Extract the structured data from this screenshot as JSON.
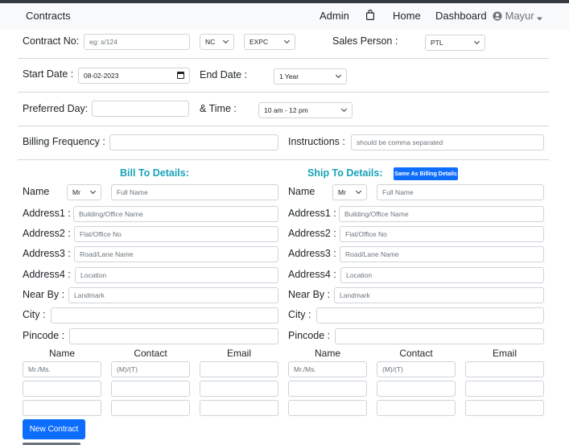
{
  "nav": {
    "brand": "Contracts",
    "admin": "Admin",
    "home": "Home",
    "dashboard": "Dashboard",
    "user": "Mayur"
  },
  "form": {
    "contract_no_label": "Contract No:",
    "contract_no_placeholder": "eg: s/124",
    "nc_value": "NC",
    "expc_value": "EXPC",
    "sales_person_label": "Sales Person :",
    "sales_person_value": "PTL",
    "start_date_label": "Start Date :",
    "start_date_value": "08-02-2023",
    "end_date_label": "End Date :",
    "end_date_value": "1 Year",
    "preferred_day_label": "Preferred Day:",
    "time_label": "& Time :",
    "time_value": "10 am - 12 pm",
    "billing_frequency_label": "Billing Frequency :",
    "instructions_label": "Instructions :",
    "instructions_placeholder": "should be comma separated"
  },
  "bill_to": {
    "title": "Bill To Details:",
    "name_label": "Name",
    "salutation": "Mr",
    "name_placeholder": "Full Name",
    "address1_label": "Address1 :",
    "address1_placeholder": "Building/Office Name",
    "address2_label": "Address2 :",
    "address2_placeholder": "Flat/Office No",
    "address3_label": "Address3 :",
    "address3_placeholder": "Road/Lane Name",
    "address4_label": "Address4 :",
    "address4_placeholder": "Location",
    "nearby_label": "Near By :",
    "nearby_placeholder": "Landmark",
    "city_label": "City :",
    "pincode_label": "Pincode :"
  },
  "ship_to": {
    "title": "Ship To Details:",
    "same_as_billing": "Same As Billing Details",
    "name_label": "Name",
    "salutation": "Mr",
    "name_placeholder": "Full Name",
    "address1_label": "Address1 :",
    "address1_placeholder": "Building/Office Name",
    "address2_label": "Address2 :",
    "address2_placeholder": "Flat/Office No",
    "address3_label": "Address3 :",
    "address3_placeholder": "Road/Lane Name",
    "address4_label": "Address4 :",
    "address4_placeholder": "Location",
    "nearby_label": "Near By :",
    "nearby_placeholder": "Landmark",
    "city_label": "City :",
    "pincode_label": "Pincode :"
  },
  "contacts": {
    "col_name": "Name",
    "col_contact": "Contact",
    "col_email": "Email",
    "name_placeholder": "Mr./Ms.",
    "contact_placeholder": "(M)/(T)"
  },
  "actions": {
    "new_contract": "New Contract"
  }
}
